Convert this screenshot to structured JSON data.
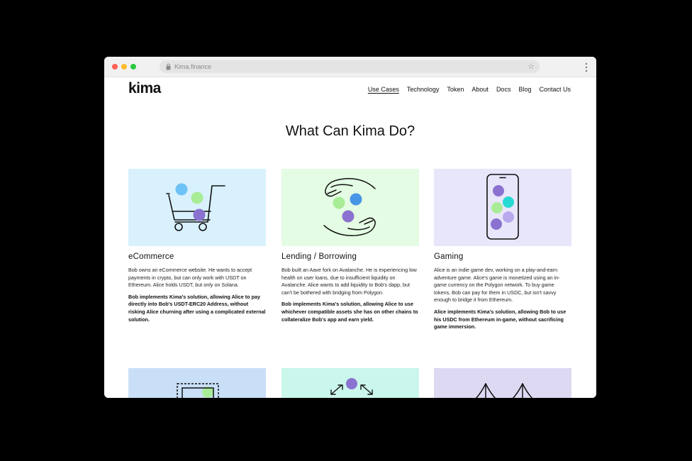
{
  "browser": {
    "url": "Kima.finance"
  },
  "header": {
    "logo": "kima",
    "nav": [
      {
        "label": "Use Cases",
        "active": true
      },
      {
        "label": "Technology"
      },
      {
        "label": "Token"
      },
      {
        "label": "About"
      },
      {
        "label": "Docs"
      },
      {
        "label": "Blog"
      },
      {
        "label": "Contact Us"
      }
    ]
  },
  "main": {
    "title": "What Can Kima Do?",
    "cards": [
      {
        "title": "eCommerce",
        "body": "Bob owns an eCommerce website. He wants to accept payments in crypto, but can only work with USDT on Ethereum. Alice holds USDT, but only on Solana.",
        "bold": "Bob implements Kima's solution, allowing Alice to pay directly into Bob's USDT-ERC20 Address, without risking Alice churning after using a complicated external solution."
      },
      {
        "title": "Lending / Borrowing",
        "body": "Bob built an Aave fork on Avalanche. He is experiencing low health on user loans, due to insufficient liquidity on Avalanche. Alice wants to add liquidity to Bob's dapp, but can't be bothered with bridging from Polygon.",
        "bold": "Bob implements Kima's solution, allowing Alice to use whichever compatible assets she has on other chains to collateralize Bob's app and earn yield."
      },
      {
        "title": "Gaming",
        "body": "Alice is an indie game dev, working on a play-and-earn adventure game. Alice's game is monetized using an in-game currency on the Polygon network. To buy game tokens, Bob can pay for them in USDC, but isn't savvy enough to bridge it from Ethereum.",
        "bold": "Alice implements Kima's solution, allowing Bob to use his USDC from Ethereum in-game, without sacrificing game immersion."
      }
    ]
  },
  "colors": {
    "card_bg": [
      "#d8f1fd",
      "#e4fce3",
      "#e8e6fa",
      "#c9dff7",
      "#caf6ec",
      "#ddd9f3"
    ],
    "coin_blue": "#6ec3f6",
    "coin_green": "#a9ec97",
    "coin_purple": "#8b72d0",
    "coin_teal": "#26d9d3",
    "coin_lilac": "#b8a8ec",
    "coin_mid_blue": "#4a96e6"
  }
}
